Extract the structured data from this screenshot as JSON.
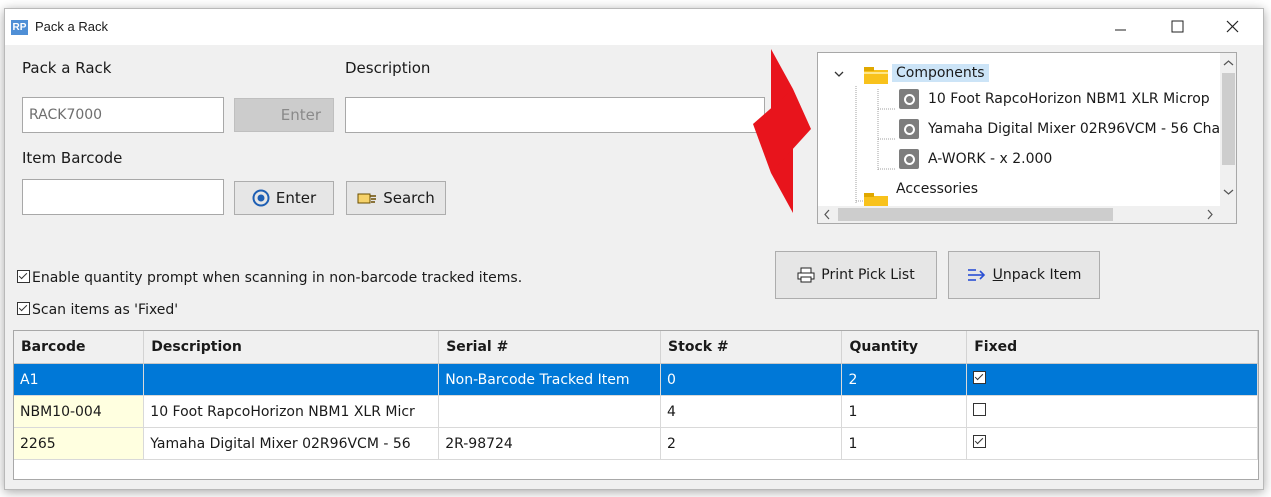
{
  "window": {
    "title": "Pack a Rack",
    "logo": "RP"
  },
  "form": {
    "pack_a_rack_label": "Pack a Rack",
    "rack_value": "RACK7000",
    "enter_disabled_label": "Enter",
    "description_label": "Description",
    "description_value": "",
    "item_barcode_label": "Item Barcode",
    "item_barcode_value": "",
    "enter_label": "Enter",
    "search_label": "Search",
    "quantity_prompt_label": "Enable quantity prompt when scanning in non-barcode tracked items.",
    "scan_fixed_label": "Scan items as 'Fixed'",
    "print_pick_list_label": "Print Pick List",
    "unpack_item_label": "Unpack Item"
  },
  "tree": {
    "components_label": "Components",
    "items": [
      "10 Foot RapcoHorizon NBM1 XLR Microp",
      "Yamaha Digital Mixer 02R96VCM - 56 Cha",
      "A-WORK  - x 2.000"
    ],
    "accessories_label": "Accessories"
  },
  "grid": {
    "columns": [
      "Barcode",
      "Description",
      "Serial #",
      "Stock #",
      "Quantity",
      "Fixed"
    ],
    "rows": [
      {
        "barcode": "A1",
        "description": "",
        "serial": "Non-Barcode Tracked Item",
        "stock": "0",
        "quantity": "2",
        "fixed": true
      },
      {
        "barcode": "NBM10-004",
        "description": "10 Foot RapcoHorizon NBM1 XLR Micr",
        "serial": "",
        "stock": "4",
        "quantity": "1",
        "fixed": false
      },
      {
        "barcode": "2265",
        "description": "Yamaha Digital Mixer 02R96VCM - 56",
        "serial": "2R-98724",
        "stock": "2",
        "quantity": "1",
        "fixed": true
      }
    ]
  },
  "colors": {
    "selection": "#0078d7",
    "arrow": "#e8141c",
    "barcode_cell": "#ffffe0"
  }
}
